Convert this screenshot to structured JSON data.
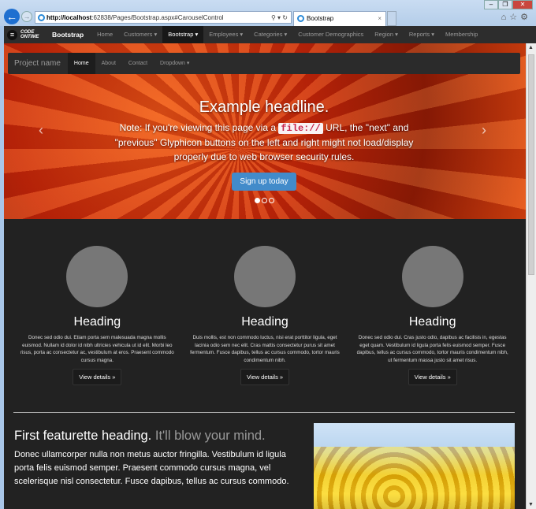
{
  "browser": {
    "url_host": "http://localhost",
    "url_rest": ":62838/Pages/Bootstrap.aspx#CarouselControl",
    "tab_title": "Bootstrap",
    "tab_close": "×",
    "addr_tools": "⚲ ▾ ↻",
    "right_icons": "⌂☆⚙",
    "win": [
      "–",
      "❐",
      "✕"
    ]
  },
  "appnav": {
    "logo": "CODE ONTIME",
    "brand": "Bootstrap",
    "items": [
      "Home",
      "Customers ▾",
      "Bootstrap ▾",
      "Employees ▾",
      "Categories ▾",
      "Customer Demographics",
      "Region ▾",
      "Reports ▾",
      "Membership"
    ]
  },
  "projectnav": {
    "name": "Project name",
    "items": [
      "Home",
      "About",
      "Contact",
      "Dropdown ▾"
    ]
  },
  "carousel": {
    "headline": "Example headline.",
    "note_before": "Note: If you're viewing this page via a ",
    "code": "file://",
    "note_after": " URL, the \"next\" and \"previous\" Glyphicon buttons on the left and right might not load/display properly due to web browser security rules.",
    "button": "Sign up today",
    "prev": "‹",
    "next": "›"
  },
  "columns": [
    {
      "heading": "Heading",
      "text": "Donec sed odio dui. Etiam porta sem malesuada magna mollis euismod. Nullam id dolor id nibh ultricies vehicula ut id elit. Morbi leo risus, porta ac consectetur ac, vestibulum at eros. Praesent commodo cursus magna.",
      "button": "View details »"
    },
    {
      "heading": "Heading",
      "text": "Duis mollis, est non commodo luctus, nisi erat porttitor ligula, eget lacinia odio sem nec elit. Cras mattis consectetur purus sit amet fermentum. Fusce dapibus, tellus ac cursus commodo, tortor mauris condimentum nibh.",
      "button": "View details »"
    },
    {
      "heading": "Heading",
      "text": "Donec sed odio dui. Cras justo odio, dapibus ac facilisis in, egestas eget quam. Vestibulum id ligula porta felis euismod semper. Fusce dapibus, tellus ac cursus commodo, tortor mauris condimentum nibh, ut fermentum massa justo sit amet risus.",
      "button": "View details »"
    }
  ],
  "featurette": {
    "heading": "First featurette heading.",
    "muted": "It'll blow your mind.",
    "text": "Donec ullamcorper nulla non metus auctor fringilla. Vestibulum id ligula porta felis euismod semper. Praesent commodo cursus magna, vel scelerisque nisl consectetur. Fusce dapibus, tellus ac cursus commodo."
  }
}
